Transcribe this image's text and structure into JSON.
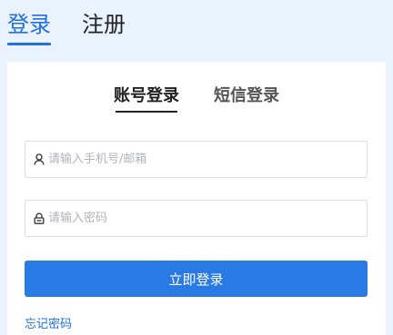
{
  "top_tabs": {
    "login": "登录",
    "register": "注册"
  },
  "login_tabs": {
    "account": "账号登录",
    "sms": "短信登录"
  },
  "form": {
    "username": {
      "placeholder": "请输入手机号/邮箱",
      "value": "",
      "icon": "user-icon"
    },
    "password": {
      "placeholder": "请输入密码",
      "value": "",
      "icon": "lock-icon"
    },
    "submit_label": "立即登录"
  },
  "links": {
    "forgot_password": "忘记密码"
  },
  "colors": {
    "accent": "#2a7ae6",
    "background": "#eaf2fd"
  }
}
